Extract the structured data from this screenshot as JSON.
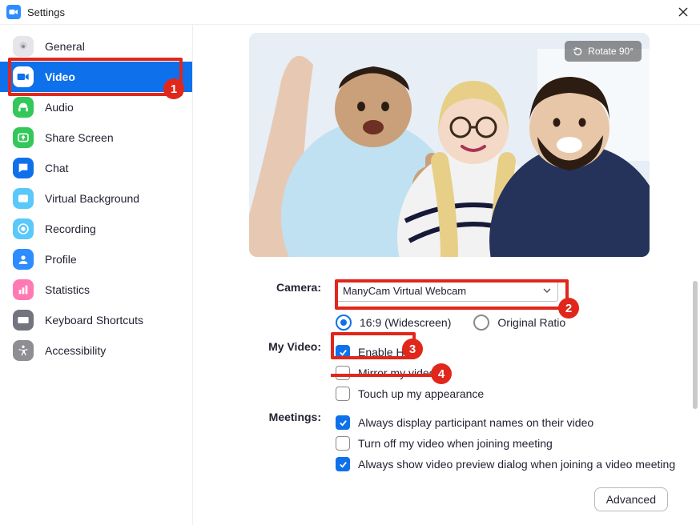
{
  "window": {
    "title": "Settings"
  },
  "sidebar": {
    "items": [
      {
        "id": "general",
        "label": "General",
        "icon": "gear",
        "bg": "#E5E5EA",
        "fg": "#8E8E93"
      },
      {
        "id": "video",
        "label": "Video",
        "icon": "video",
        "bg": "#FFFFFF",
        "fg": "#0E71EB",
        "active": true
      },
      {
        "id": "audio",
        "label": "Audio",
        "icon": "headset",
        "bg": "#34C759",
        "fg": "#FFFFFF"
      },
      {
        "id": "share",
        "label": "Share Screen",
        "icon": "share",
        "bg": "#34C759",
        "fg": "#FFFFFF"
      },
      {
        "id": "chat",
        "label": "Chat",
        "icon": "chat",
        "bg": "#0E71EB",
        "fg": "#FFFFFF"
      },
      {
        "id": "vbg",
        "label": "Virtual Background",
        "icon": "image",
        "bg": "#5AC8FA",
        "fg": "#FFFFFF"
      },
      {
        "id": "rec",
        "label": "Recording",
        "icon": "record",
        "bg": "#5AC8FA",
        "fg": "#FFFFFF"
      },
      {
        "id": "profile",
        "label": "Profile",
        "icon": "profile",
        "bg": "#2D8CFF",
        "fg": "#FFFFFF"
      },
      {
        "id": "stats",
        "label": "Statistics",
        "icon": "stats",
        "bg": "#FF7AB3",
        "fg": "#FFFFFF"
      },
      {
        "id": "keys",
        "label": "Keyboard Shortcuts",
        "icon": "keyboard",
        "bg": "#747480",
        "fg": "#FFFFFF"
      },
      {
        "id": "a11y",
        "label": "Accessibility",
        "icon": "a11y",
        "bg": "#8E8E93",
        "fg": "#FFFFFF"
      }
    ]
  },
  "preview": {
    "rotate_label": "Rotate 90°"
  },
  "settings": {
    "camera_label": "Camera:",
    "camera_value": "ManyCam Virtual Webcam",
    "aspect": {
      "wide": "16:9 (Widescreen)",
      "orig": "Original Ratio",
      "selected": "wide"
    },
    "myvideo_label": "My Video:",
    "myvideo": {
      "hd": {
        "label": "Enable HD",
        "checked": true
      },
      "mirror": {
        "label": "Mirror my video",
        "checked": false
      },
      "touchup": {
        "label": "Touch up my appearance",
        "checked": false
      }
    },
    "meetings_label": "Meetings:",
    "meetings": {
      "names": {
        "label": "Always display participant names on their video",
        "checked": true
      },
      "turnoff": {
        "label": "Turn off my video when joining meeting",
        "checked": false
      },
      "preview": {
        "label": "Always show video preview dialog when joining a video meeting",
        "checked": true
      }
    },
    "advanced_label": "Advanced"
  },
  "annotations": {
    "n1": "1",
    "n2": "2",
    "n3": "3",
    "n4": "4"
  }
}
